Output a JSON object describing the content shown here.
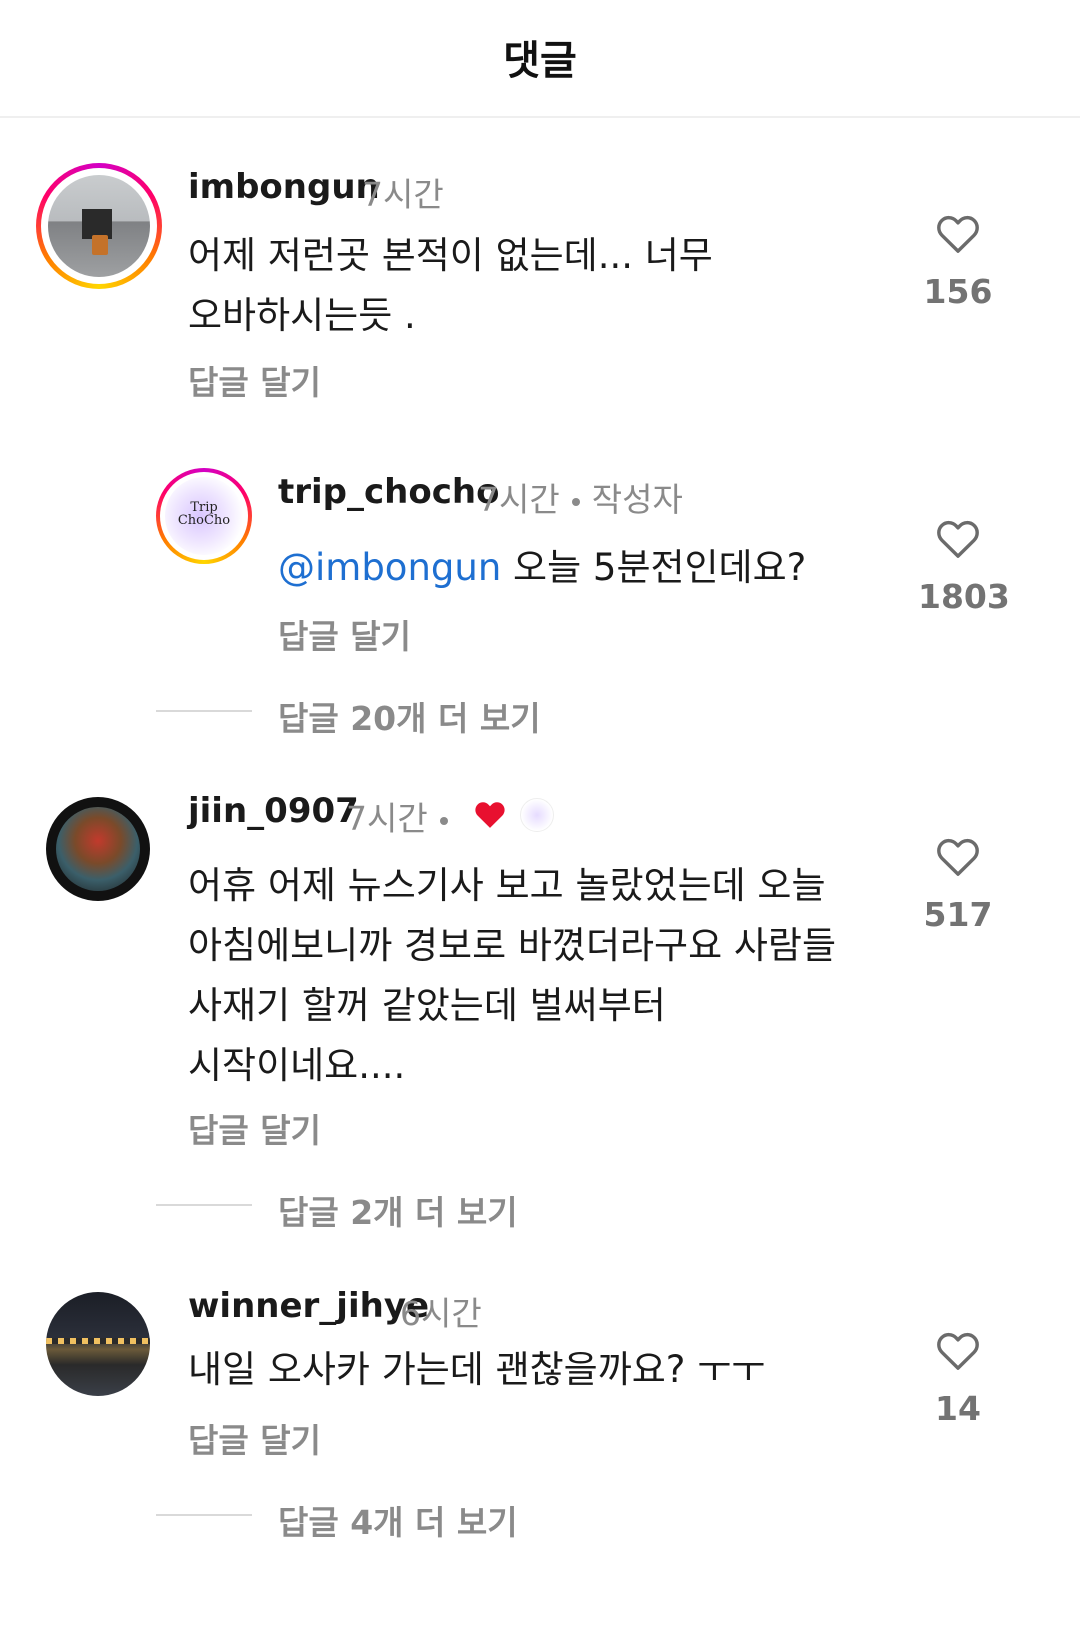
{
  "header": {
    "title": "댓글"
  },
  "comments": [
    {
      "username": "imbongun",
      "time": "7시간",
      "lines": [
        "어제 저런곳 본적이 없는데... 너무",
        "오바하시는듯 ."
      ],
      "reply_label": "답글 달기",
      "likes": "156"
    },
    {
      "username": "trip_chocho",
      "time": "7시간",
      "author_badge": "작성자",
      "mention": "@imbongun",
      "text": " 오늘 5분전인데요?",
      "reply_label": "답글 달기",
      "likes": "1803",
      "avatar_logo": [
        "Trip",
        "ChoCho"
      ]
    },
    {
      "username": "jiin_0907",
      "time": "7시간",
      "lines": [
        "어휴 어제 뉴스기사 보고 놀랐었는데 오늘",
        "아침에보니까 경보로 바꼈더라구요  사람들",
        "사재기 할꺼 같았는데 벌써부터",
        "시작이네요...."
      ],
      "reply_label": "답글 달기",
      "likes": "517"
    },
    {
      "username": "winner_jihye",
      "time": "6시간",
      "lines": [
        "내일 오사카 가는데 괜찮을까요? ㅜㅜ"
      ],
      "reply_label": "답글 달기",
      "likes": "14"
    }
  ],
  "more_replies": [
    "답글 20개 더 보기",
    "답글 2개 더 보기",
    "답글 4개 더 보기"
  ],
  "colors": {
    "mention": "#1e6fd1",
    "heart_red": "#e8102f",
    "muted": "#8a8a8a"
  }
}
